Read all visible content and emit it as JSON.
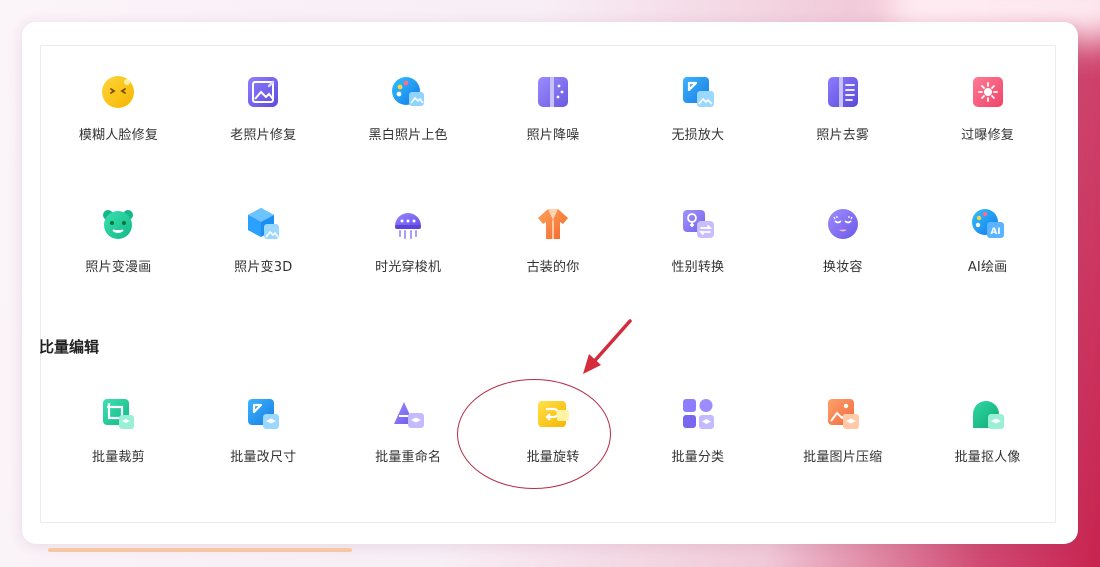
{
  "colors": {
    "accent_red": "#c8234f",
    "annotation_red": "#b52b45",
    "progress_bar": "#f5c7a2"
  },
  "tools_row1": [
    {
      "label": "模糊人脸修复",
      "icon": "blurred-face-icon"
    },
    {
      "label": "老照片修复",
      "icon": "old-photo-icon"
    },
    {
      "label": "黑白照片上色",
      "icon": "palette-icon"
    },
    {
      "label": "照片降噪",
      "icon": "denoise-icon"
    },
    {
      "label": "无损放大",
      "icon": "enlarge-icon"
    },
    {
      "label": "照片去雾",
      "icon": "dehaze-icon"
    },
    {
      "label": "过曝修复",
      "icon": "overexposure-icon"
    }
  ],
  "tools_row2": [
    {
      "label": "照片变漫画",
      "icon": "cartoon-face-icon"
    },
    {
      "label": "照片变3D",
      "icon": "cube-3d-icon"
    },
    {
      "label": "时光穿梭机",
      "icon": "time-machine-icon"
    },
    {
      "label": "古装的你",
      "icon": "costume-icon"
    },
    {
      "label": "性别转换",
      "icon": "gender-swap-icon"
    },
    {
      "label": "换妆容",
      "icon": "makeup-icon"
    },
    {
      "label": "AI绘画",
      "icon": "ai-paint-icon"
    }
  ],
  "section": {
    "title": "批量编辑",
    "title_visible": "比量编辑"
  },
  "tools_row3": [
    {
      "label": "批量裁剪",
      "icon": "batch-crop-icon"
    },
    {
      "label": "批量改尺寸",
      "icon": "batch-resize-icon"
    },
    {
      "label": "批量重命名",
      "icon": "batch-rename-icon"
    },
    {
      "label": "批量旋转",
      "icon": "batch-rotate-icon"
    },
    {
      "label": "批量分类",
      "icon": "batch-classify-icon"
    },
    {
      "label": "批量图片压缩",
      "icon": "batch-compress-icon"
    },
    {
      "label": "批量抠人像",
      "icon": "batch-cutout-icon"
    }
  ]
}
